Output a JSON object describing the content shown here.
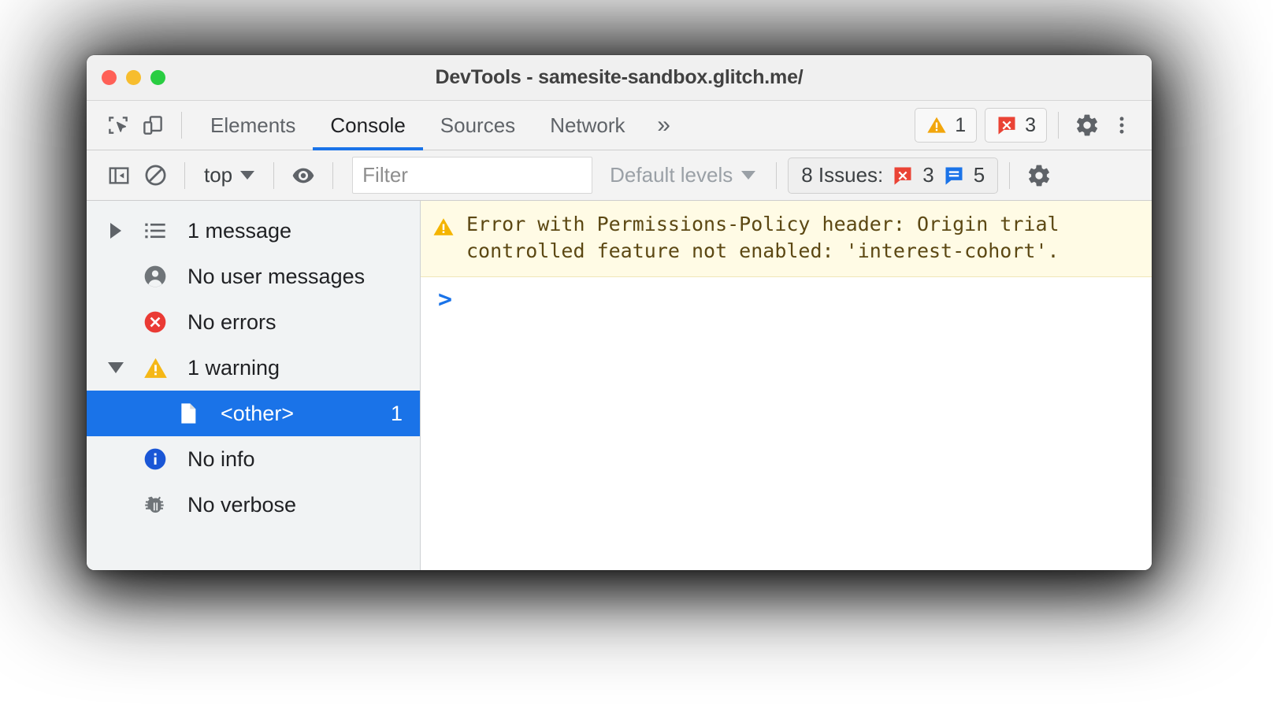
{
  "window": {
    "title": "DevTools - samesite-sandbox.glitch.me/",
    "traffic_lights": [
      "close",
      "minimize",
      "maximize"
    ]
  },
  "main_toolbar": {
    "icons": [
      {
        "name": "inspect-element-icon",
        "label": "Inspect element"
      },
      {
        "name": "device-toolbar-icon",
        "label": "Toggle device toolbar"
      }
    ],
    "tabs": [
      {
        "label": "Elements",
        "active": false
      },
      {
        "label": "Console",
        "active": true
      },
      {
        "label": "Sources",
        "active": false
      },
      {
        "label": "Network",
        "active": false
      }
    ],
    "more_tabs_glyph": "»",
    "warning_count": "1",
    "error_count": "3",
    "settings_label": "Settings",
    "more_options_label": "Customize and control DevTools"
  },
  "console_toolbar": {
    "sidebar_toggle_label": "Hide console sidebar",
    "clear_console_label": "Clear console",
    "context": "top",
    "live_expression_label": "Create live expression",
    "filter": {
      "value": "",
      "placeholder": "Filter"
    },
    "levels": "Default levels",
    "issues": {
      "prefix": "8 Issues:",
      "error_count": "3",
      "info_count": "5"
    },
    "settings_label": "Console settings"
  },
  "sidebar": {
    "items": [
      {
        "icon": "list-icon",
        "twisty": "collapsed",
        "label": "1 message",
        "count": "",
        "selected": false
      },
      {
        "icon": "user-icon",
        "twisty": "none",
        "label": "No user messages",
        "count": "",
        "selected": false
      },
      {
        "icon": "error-icon",
        "twisty": "none",
        "label": "No errors",
        "count": "",
        "selected": false
      },
      {
        "icon": "warning-icon",
        "twisty": "expanded",
        "label": "1 warning",
        "count": "",
        "selected": false
      },
      {
        "icon": "file-icon",
        "twisty": "none",
        "label": "<other>",
        "count": "1",
        "selected": true
      },
      {
        "icon": "info-icon",
        "twisty": "none",
        "label": "No info",
        "count": "",
        "selected": false
      },
      {
        "icon": "verbose-icon",
        "twisty": "none",
        "label": "No verbose",
        "count": "",
        "selected": false
      }
    ]
  },
  "console": {
    "messages": [
      {
        "level": "warning",
        "text": "Error with Permissions-Policy header: Origin trial\ncontrolled feature not enabled: 'interest-cohort'."
      }
    ],
    "prompt_glyph": ">"
  },
  "colors": {
    "accent_blue": "#1a73e8",
    "warning_yellow": "#f2a60c",
    "error_red": "#ea4335",
    "info_blue": "#1a73e8",
    "warning_bg": "#fffbe5",
    "warning_text": "#5c4813",
    "sidebar_bg": "#f1f3f4",
    "toolbar_bg": "#f3f3f3"
  }
}
